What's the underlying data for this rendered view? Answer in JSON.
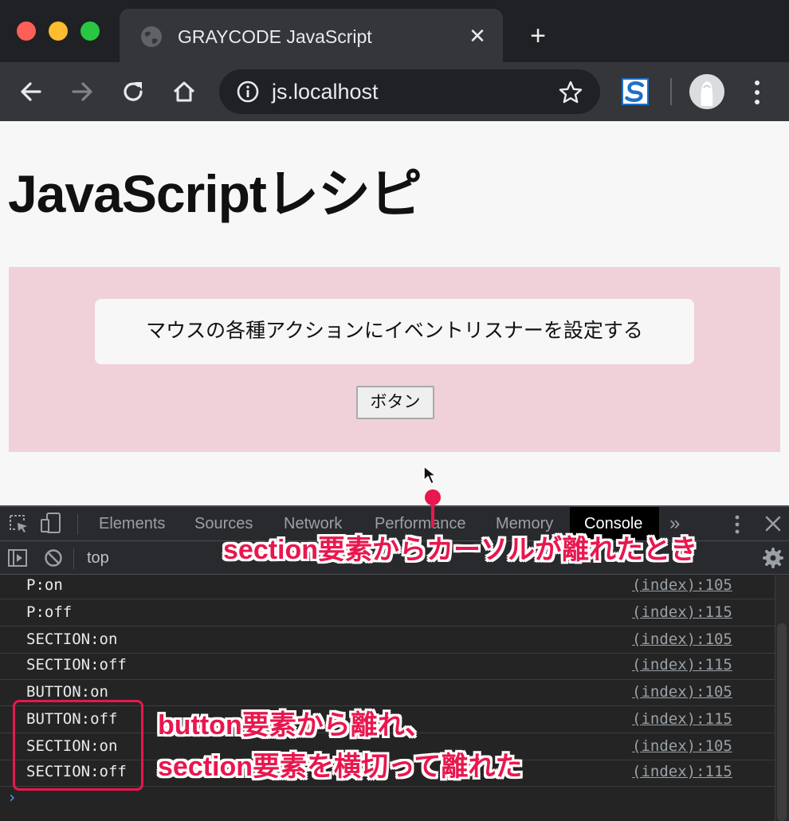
{
  "browser": {
    "tab_title": "GRAYCODE JavaScript",
    "tab_close": "✕",
    "new_tab": "+",
    "url": "js.localhost"
  },
  "page": {
    "title": "JavaScriptレシピ",
    "card_text": "マウスの各種アクションにイベントリスナーを設定する",
    "button_label": "ボタン"
  },
  "devtools": {
    "tabs": [
      "Elements",
      "Sources",
      "Network",
      "Performance",
      "Memory",
      "Console"
    ],
    "active_tab": "Console",
    "more_tabs": "»",
    "context": "top",
    "logs": [
      {
        "message": "P:on",
        "source": "(index):105"
      },
      {
        "message": "P:off",
        "source": "(index):115"
      },
      {
        "message": "SECTION:on",
        "source": "(index):105"
      },
      {
        "message": "SECTION:off",
        "source": "(index):115"
      },
      {
        "message": "BUTTON:on",
        "source": "(index):105"
      },
      {
        "message": "BUTTON:off",
        "source": "(index):115"
      },
      {
        "message": "SECTION:on",
        "source": "(index):105"
      },
      {
        "message": "SECTION:off",
        "source": "(index):115"
      }
    ],
    "prompt": "›"
  },
  "annotations": {
    "top_note": "section要素からカーソルが離れたとき",
    "bottom_note_line1": "button要素から離れ、",
    "bottom_note_line2": "section要素を横切って離れた",
    "accent_color": "#e8174e"
  }
}
